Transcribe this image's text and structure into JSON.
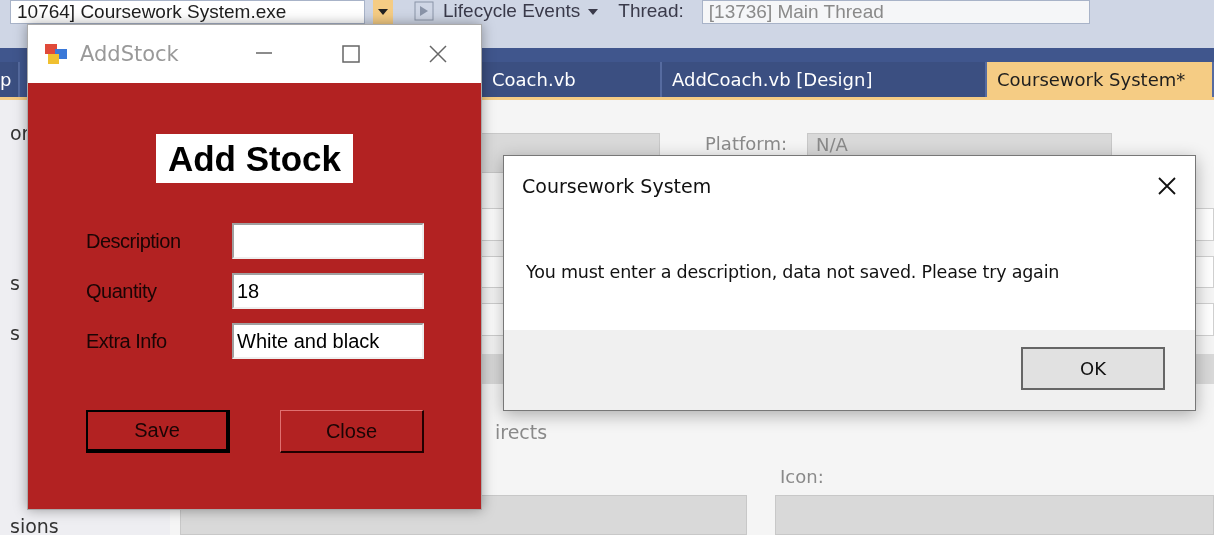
{
  "ide": {
    "toolbar": {
      "process": "10764] Coursework System.exe",
      "event": "Lifecycle Events",
      "thread_label": "Thread:",
      "thread": "[13736] Main Thread"
    },
    "tabs": [
      {
        "label": "p",
        "selected": false
      },
      {
        "label": "Coach.vb",
        "selected": false
      },
      {
        "label": "AddCoach.vb [Design]",
        "selected": false
      },
      {
        "label": "Coursework System*",
        "selected": true
      }
    ],
    "sidebar": {
      "items": [
        "or",
        "s",
        "s",
        "sions"
      ]
    },
    "properties": {
      "platform_label": "Platform:",
      "platform": "N/A",
      "section": "irects",
      "icon_label": "Icon:"
    }
  },
  "add_stock": {
    "title": "AddStock",
    "heading": "Add Stock",
    "fields": [
      {
        "label": "Description"
      },
      {
        "label": "Quantity",
        "value": "18"
      },
      {
        "label": "Extra Info",
        "value": "White and black"
      }
    ],
    "buttons": [
      {
        "label": "Save",
        "focused": true
      },
      {
        "label": "Close",
        "focused": false
      }
    ]
  },
  "message_box": {
    "title": "Coursework System",
    "message": "You must enter a description, data not saved. Please try again",
    "buttons": [
      "OK"
    ]
  }
}
